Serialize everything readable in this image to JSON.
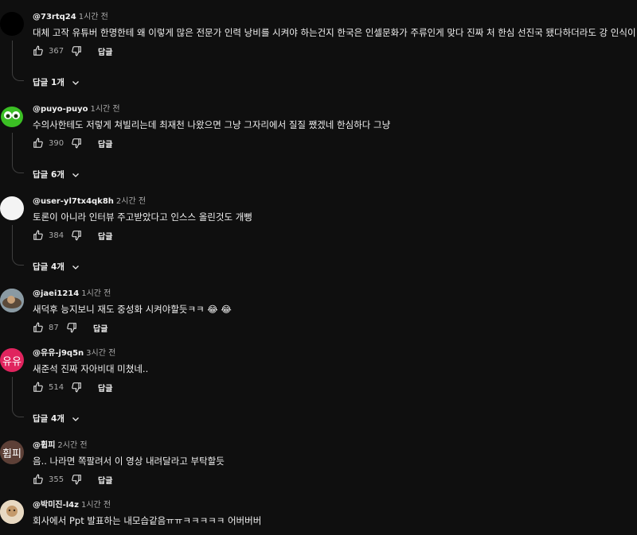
{
  "comments": [
    {
      "author": "@73rtq24",
      "time": "1시간 전",
      "text": "대체 고작 유튜버 한명한테 왜 이렇게 많은 전문가 인력 낭비를 시켜야 하는건지 한국은 인셀문화가 주류인게 맞다 진짜 처 한심 선진국 됐다하더라도 강 인식이 천박함",
      "likes": "367",
      "reply_label": "답글",
      "replies_label": "답글 1개",
      "avatar_color": "#000000"
    },
    {
      "author": "@puyo-puyo",
      "time": "1시간 전",
      "text": "수의사한테도 저렇게 쳐빌리는데 최재천 나왔으면 그냥 그자리에서 질질 쨌겠네 한심하다 그냥",
      "likes": "390",
      "reply_label": "답글",
      "replies_label": "답글 6개",
      "avatar_color": "#2f9a1f"
    },
    {
      "author": "@user-yl7tx4qk8h",
      "time": "2시간 전",
      "text": "토론이 아니라 인터뷰 주고받았다고 인스스 올린것도 개뻥",
      "likes": "384",
      "reply_label": "답글",
      "replies_label": "답글 4개",
      "avatar_color": "#f4f4f4"
    },
    {
      "author": "@jaei1214",
      "time": "1시간 전",
      "text": "새덕후 능지보니 재도 중성화 시켜야할듯ㅋㅋ 😂 😂",
      "likes": "87",
      "reply_label": "답글",
      "avatar_color": "#6b7c86"
    },
    {
      "author": "@유유-j9q5n",
      "time": "3시간 전",
      "text": "새준석 진짜 자아비대 미쳤네..",
      "likes": "514",
      "reply_label": "답글",
      "replies_label": "답글 4개",
      "avatar_color": "#e0245e",
      "avatar_text": "유유"
    },
    {
      "author": "@휩피",
      "time": "2시간 전",
      "text": "음.. 나라면 쪽팔려서 이 영상 내려달라고 부탁할듯",
      "likes": "355",
      "reply_label": "답글",
      "avatar_color": "#5d4037",
      "avatar_text": "휩피"
    },
    {
      "author": "@박미진-l4z",
      "time": "1시간 전",
      "text": "회사에서 Ppt 발표하는 내모습같음ㅠㅠㅋㅋㅋㅋㅋ 어버버버",
      "likes": "",
      "reply_label": "",
      "avatar_color": "#d9c3a5"
    }
  ]
}
